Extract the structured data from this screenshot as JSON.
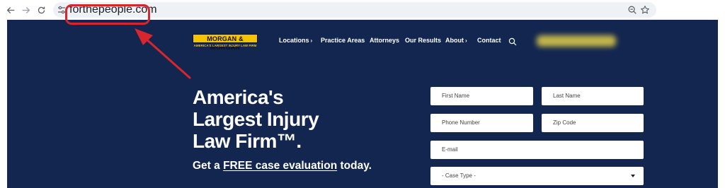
{
  "browser": {
    "url": "forthepeople.com",
    "back_icon": "arrow-left-icon",
    "forward_icon": "arrow-right-icon",
    "reload_icon": "reload-icon",
    "site_info_icon": "tune-icon",
    "zoom_icon": "zoom-icon",
    "bookmark_icon": "star-icon"
  },
  "site": {
    "logo": {
      "name": "MORGAN & MORGAN",
      "tagline": "AMERICA'S LARGEST INJURY LAW FIRM"
    },
    "nav": {
      "locations": "Locations",
      "practice_areas": "Practice Areas",
      "attorneys": "Attorneys",
      "our_results": "Our Results",
      "about": "About",
      "contact": "Contact",
      "chevron": "›"
    },
    "hero": {
      "line1": "America's",
      "line2": "Largest Injury",
      "line3": "Law Firm™.",
      "cta_before": "Get a ",
      "cta_link": "FREE case evaluation",
      "cta_after": " today."
    },
    "form": {
      "first_name": "First Name",
      "last_name": "Last Name",
      "phone": "Phone Number",
      "zip": "Zip Code",
      "email": "E-mail",
      "case_type": "- Case Type -"
    }
  },
  "colors": {
    "site_background": "#12264f",
    "highlight": "#d7262d",
    "logo_yellow": "#f5c400"
  }
}
